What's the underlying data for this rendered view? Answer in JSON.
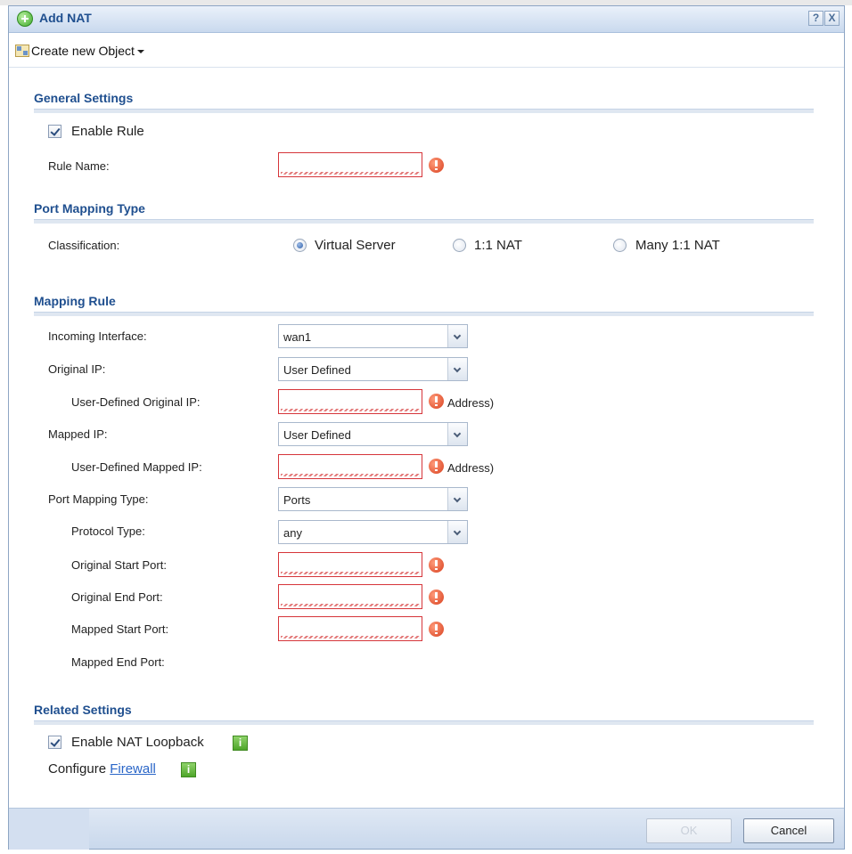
{
  "window": {
    "title": "Add NAT",
    "help_label": "?",
    "close_label": "X"
  },
  "toolbar": {
    "create_object_label": "Create new Object"
  },
  "general": {
    "section_title": "General Settings",
    "enable_rule_label": "Enable Rule",
    "enable_rule_checked": true,
    "rule_name_label": "Rule Name:",
    "rule_name_value": ""
  },
  "port_mapping_type_section": {
    "section_title": "Port Mapping Type",
    "classification_label": "Classification:",
    "options": [
      {
        "label": "Virtual Server",
        "selected": true
      },
      {
        "label": "1:1 NAT",
        "selected": false
      },
      {
        "label": "Many 1:1 NAT",
        "selected": false
      }
    ]
  },
  "mapping_rule": {
    "section_title": "Mapping Rule",
    "incoming_interface": {
      "label": "Incoming Interface:",
      "value": "wan1"
    },
    "original_ip": {
      "label": "Original IP:",
      "value": "User Defined"
    },
    "user_defined_original_ip": {
      "label": "User-Defined Original IP:",
      "value": "",
      "suffix": "Address)"
    },
    "mapped_ip": {
      "label": "Mapped IP:",
      "value": "User Defined"
    },
    "user_defined_mapped_ip": {
      "label": "User-Defined Mapped IP:",
      "value": "",
      "suffix": "Address)"
    },
    "port_mapping_type": {
      "label": "Port Mapping Type:",
      "value": "Ports"
    },
    "protocol_type": {
      "label": "Protocol Type:",
      "value": "any"
    },
    "original_start_port": {
      "label": "Original Start Port:",
      "value": ""
    },
    "original_end_port": {
      "label": "Original End Port:",
      "value": ""
    },
    "mapped_start_port": {
      "label": "Mapped Start Port:",
      "value": ""
    },
    "mapped_end_port": {
      "label": "Mapped End Port:"
    }
  },
  "related": {
    "section_title": "Related Settings",
    "enable_nat_loopback_label": "Enable NAT Loopback",
    "enable_nat_loopback_checked": true,
    "configure_label": "Configure",
    "firewall_link": "Firewall",
    "info_label": "i"
  },
  "footer": {
    "ok_label": "OK",
    "cancel_label": "Cancel"
  },
  "colors": {
    "section_title": "#1f4f8f",
    "error_border": "#d6353a",
    "link": "#2a66c8",
    "info_green": "#4ea52a"
  }
}
